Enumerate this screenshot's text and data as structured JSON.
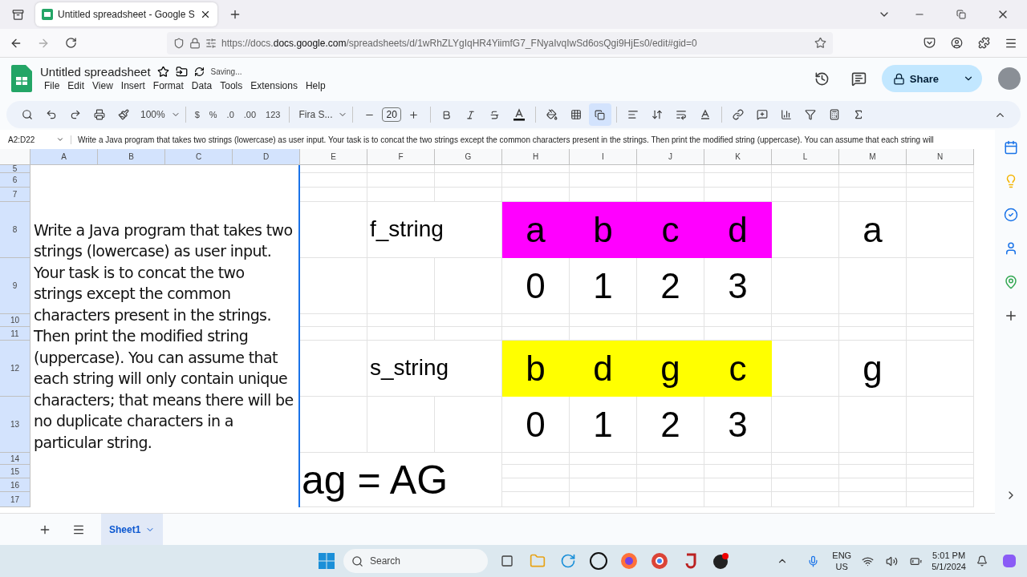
{
  "browser": {
    "tabs": [
      {
        "title": "Untitled spreadsheet - Google S",
        "selected": true
      }
    ],
    "url_host": "docs.google.com",
    "url_pre": "https://docs.",
    "url_post": "/spreadsheets/d/1wRhZLYgIqHR4YiimfG7_FNyaIvqIwSd6osQgi9HjEs0/edit#gid=0"
  },
  "app": {
    "title": "Untitled spreadsheet",
    "status": "Saving...",
    "menu": [
      "File",
      "Edit",
      "View",
      "Insert",
      "Format",
      "Data",
      "Tools",
      "Extensions",
      "Help"
    ],
    "share": "Share"
  },
  "toolbar": {
    "zoom": "100%",
    "number_formats": [
      "$",
      "%",
      ".0",
      ".00",
      "123"
    ],
    "font": "Fira S...",
    "font_size": "20"
  },
  "formula_bar": {
    "name_box": "A2:D22",
    "formula": "Write a Java program that takes two strings (lowercase) as user input. Your task is to concat the two strings except the common characters present in the strings. Then print the modified string (uppercase). You can assume that each string will"
  },
  "columns": [
    {
      "label": "A",
      "selected": true
    },
    {
      "label": "B",
      "selected": true
    },
    {
      "label": "C",
      "selected": true
    },
    {
      "label": "D",
      "selected": true
    },
    {
      "label": "E",
      "selected": false
    },
    {
      "label": "F",
      "selected": false
    },
    {
      "label": "G",
      "selected": false
    },
    {
      "label": "H",
      "selected": false
    },
    {
      "label": "I",
      "selected": false
    },
    {
      "label": "J",
      "selected": false
    },
    {
      "label": "K",
      "selected": false
    },
    {
      "label": "L",
      "selected": false
    },
    {
      "label": "M",
      "selected": false
    },
    {
      "label": "N",
      "selected": false
    }
  ],
  "rows": [
    {
      "label": "5",
      "selected": true
    },
    {
      "label": "6",
      "selected": true
    },
    {
      "label": "7",
      "selected": true
    },
    {
      "label": "8",
      "selected": true
    },
    {
      "label": "9",
      "selected": true
    },
    {
      "label": "10",
      "selected": true
    },
    {
      "label": "11",
      "selected": true
    },
    {
      "label": "12",
      "selected": true
    },
    {
      "label": "13",
      "selected": true
    },
    {
      "label": "14",
      "selected": true
    },
    {
      "label": "15",
      "selected": true
    },
    {
      "label": "16",
      "selected": true
    },
    {
      "label": "17",
      "selected": true
    }
  ],
  "description": "Write a Java program that takes two strings (lowercase) as user input. Your task is to concat the two strings except the common characters present in the strings. Then print the modified string (uppercase). You can assume that each string will only contain unique characters; that means there will be no duplicate characters in a particular string.",
  "arrays": [
    {
      "label": "f_string",
      "color": "#ff00ff",
      "chars": [
        "a",
        "b",
        "c",
        "d"
      ],
      "indices": [
        "0",
        "1",
        "2",
        "3"
      ],
      "extra": "a"
    },
    {
      "label": "s_string",
      "color": "#ffff00",
      "chars": [
        "b",
        "d",
        "g",
        "c"
      ],
      "indices": [
        "0",
        "1",
        "2",
        "3"
      ],
      "extra": "g"
    }
  ],
  "result": "ag = AG",
  "sheets": [
    {
      "name": "Sheet1",
      "selected": true
    }
  ],
  "taskbar": {
    "search": "Search",
    "language": "ENG",
    "region": "US",
    "time": "5:01 PM",
    "date": "5/1/2024"
  }
}
